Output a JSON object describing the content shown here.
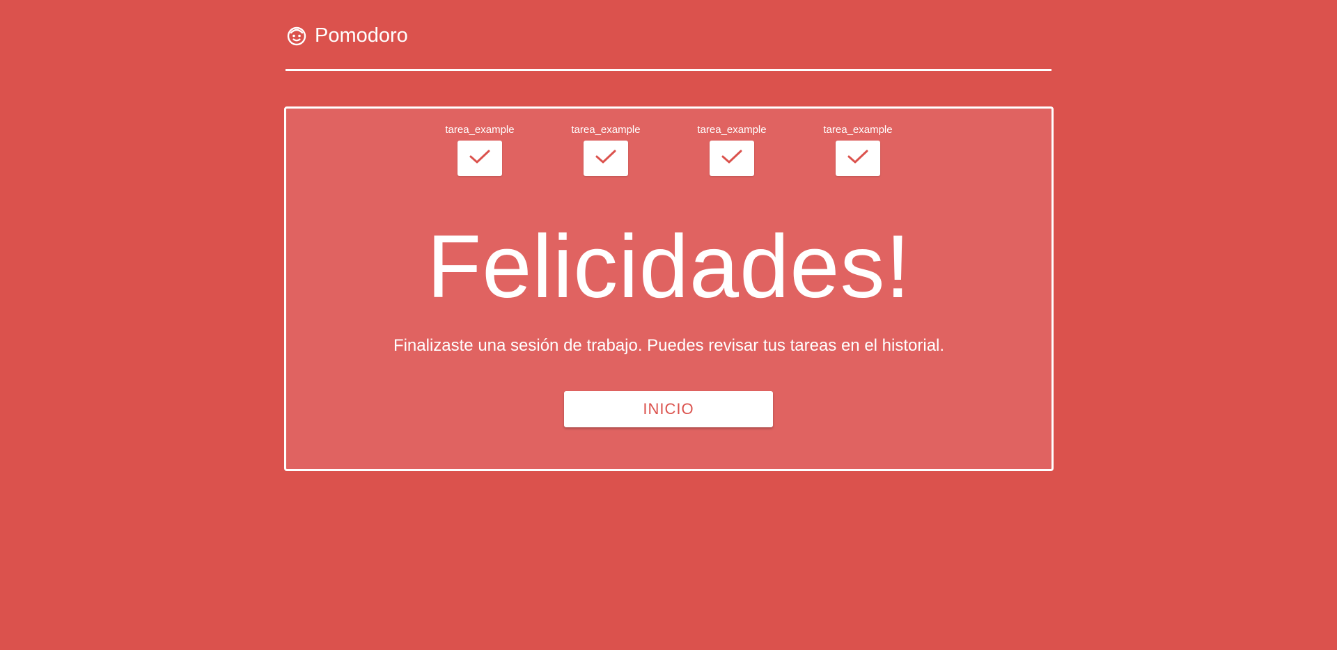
{
  "app": {
    "title": "Pomodoro",
    "logo_icon": "face-smile-icon"
  },
  "theme": {
    "background": "#db524d",
    "card_background": "#e06361",
    "accent": "#db524d",
    "text": "#ffffff"
  },
  "tasks": [
    {
      "label": "tarea_example",
      "icon": "check-icon",
      "done": true
    },
    {
      "label": "tarea_example",
      "icon": "check-icon",
      "done": true
    },
    {
      "label": "tarea_example",
      "icon": "check-icon",
      "done": true
    },
    {
      "label": "tarea_example",
      "icon": "check-icon",
      "done": true
    }
  ],
  "result": {
    "headline": "Felicidades!",
    "message": "Finalizaste una sesión de trabajo. Puedes revisar tus tareas en el historial.",
    "button_label": "INICIO"
  }
}
